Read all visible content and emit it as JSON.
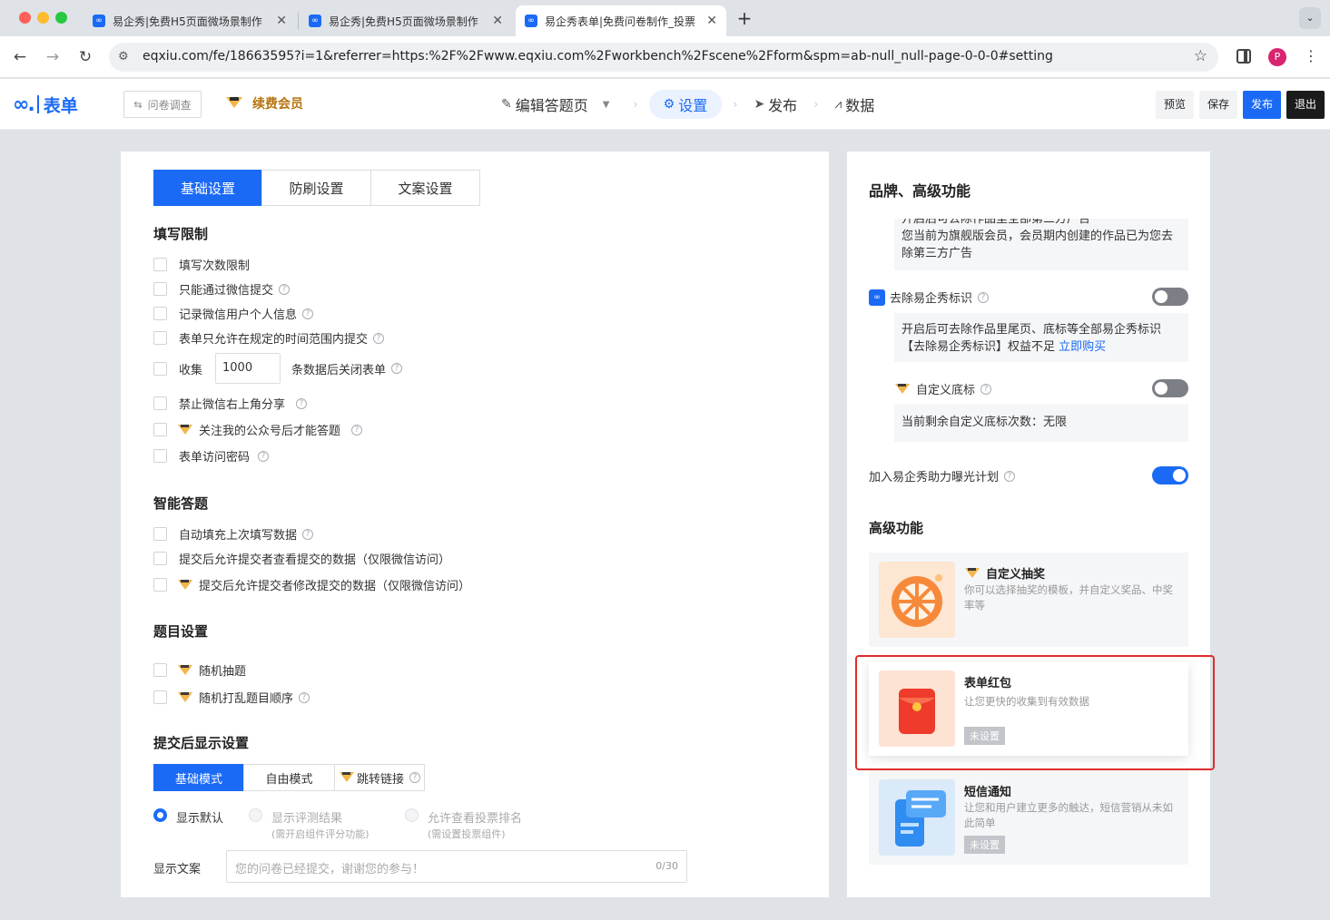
{
  "browser": {
    "tabs": [
      {
        "title": "易企秀|免费H5页面微场景制作"
      },
      {
        "title": "易企秀|免费H5页面微场景制作"
      },
      {
        "title": "易企秀表单|免费问卷制作_投票"
      }
    ],
    "url": "eqxiu.com/fe/18663595?i=1&referrer=https:%2F%2Fwww.eqxiu.com%2Fworkbench%2Fscene%2Fform&spm=ab-null_null-page-0-0-0#setting",
    "profile_initial": "P"
  },
  "header": {
    "logo_text": "表单",
    "survey_switch": "问卷调查",
    "vip_label": "续费会员",
    "steps": {
      "edit": "编辑答题页",
      "settings": "设置",
      "publish": "发布",
      "data": "数据"
    },
    "buttons": {
      "preview": "预览",
      "save": "保存",
      "publish": "发布",
      "exit": "退出"
    }
  },
  "left": {
    "tabs": [
      "基础设置",
      "防刷设置",
      "文案设置"
    ],
    "fill_limit": {
      "title": "填写限制",
      "items": {
        "count_limit": "填写次数限制",
        "wechat_only": "只能通过微信提交",
        "record_wechat": "记录微信用户个人信息",
        "time_range": "表单只允许在规定的时间范围内提交",
        "collect_prefix": "收集",
        "collect_value": "1000",
        "collect_suffix": "条数据后关闭表单",
        "no_share": "禁止微信右上角分享",
        "follow_account": "关注我的公众号后才能答题",
        "password": "表单访问密码"
      }
    },
    "smart": {
      "title": "智能答题",
      "items": {
        "autofill": "自动填充上次填写数据",
        "view_after": "提交后允许提交者查看提交的数据（仅限微信访问）",
        "edit_after": "提交后允许提交者修改提交的数据（仅限微信访问）"
      }
    },
    "question": {
      "title": "题目设置",
      "items": {
        "random_pick": "随机抽题",
        "shuffle": "随机打乱题目顺序"
      }
    },
    "after_submit": {
      "title": "提交后显示设置",
      "modes": [
        "基础模式",
        "自由模式",
        "跳转链接"
      ],
      "radios": {
        "default": "显示默认",
        "score": "显示评测结果",
        "score_sub": "(需开启组件评分功能)",
        "rank": "允许查看投票排名",
        "rank_sub": "(需设置投票组件)"
      },
      "text_label": "显示文案",
      "text_placeholder": "您的问卷已经提交，谢谢您的参与！",
      "text_count": "0/30"
    }
  },
  "right": {
    "brand_title": "品牌、高级功能",
    "ad_text_cut": "开启后可去除作品里全部第三方广告",
    "ad_text": "您当前为旗舰版会员，会员期内创建的作品已为您去除第三方广告",
    "remove_logo": {
      "label": "去除易企秀标识",
      "desc": "开启后可去除作品里尾页、底标等全部易企秀标识",
      "warn": "【去除易企秀标识】权益不足",
      "buy_link": "立即购买"
    },
    "custom_footer": {
      "label": "自定义底标",
      "remaining": "当前剩余自定义底标次数：无限"
    },
    "exposure_plan": "加入易企秀助力曝光计划",
    "advanced_title": "高级功能",
    "cards": [
      {
        "title": "自定义抽奖",
        "desc": "你可以选择抽奖的模板，并自定义奖品、中奖率等"
      },
      {
        "title": "表单红包",
        "desc": "让您更快的收集到有效数据",
        "badge": "未设置"
      },
      {
        "title": "短信通知",
        "desc": "让您和用户建立更多的触达，短信营销从未如此简单",
        "badge": "未设置"
      }
    ]
  },
  "colors": {
    "primary": "#1a6af6",
    "highlight_border": "#e12b2b",
    "crown": "#f3b64a"
  },
  "icons": {
    "help": "?",
    "star": "☆",
    "kebab": "⋮"
  }
}
